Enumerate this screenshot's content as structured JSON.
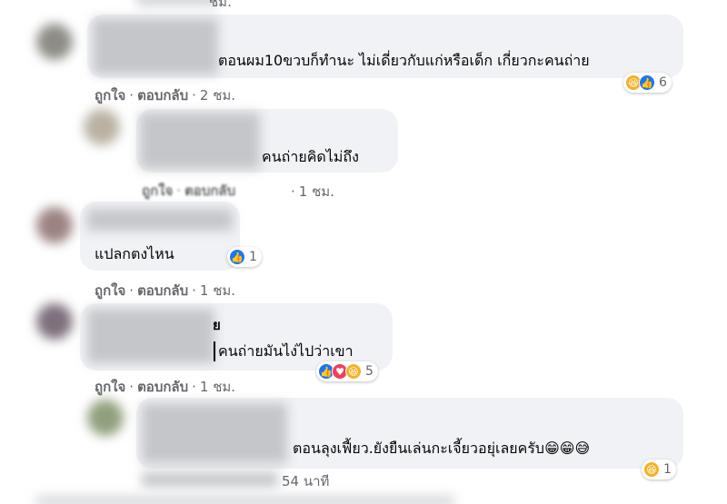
{
  "top_fragment": "ชม.",
  "comments": [
    {
      "text": "ตอนผม10ขวบก็ทำนะ ไม่เดี่ยวกับแก่หรือเด็ก เกี่ยวกะคนถ่าย",
      "like": "ถูกใจ",
      "reply": "ตอบกลับ",
      "time": "2 ชม.",
      "reaction_count": "6"
    },
    {
      "text": "คนถ่ายคิดไม่ถึง",
      "like": "ถูกใจ",
      "reply": "ตอบกลับ",
      "time": "1 ชม."
    },
    {
      "text": "แปลกตงไหน",
      "like": "ถูกใจ",
      "reply": "ตอบกลับ",
      "time": "1 ชม.",
      "reaction_count": "1"
    },
    {
      "name_fragment": "ย",
      "text": "คนถ่ายมันไง่ไปว่าเขา",
      "like": "ถูกใจ",
      "reply": "ตอบกลับ",
      "time": "1 ชม.",
      "reaction_count": "5"
    },
    {
      "text": "ตอนลุงเฟี้ยว.ยังยืนเล่นกะเจี้ยวอยุ่เลยครับ😁😁😅",
      "time": "54 นาที",
      "reaction_count": "1"
    }
  ],
  "colors": {
    "bubble": "#f0f2f5",
    "meta": "#65676b",
    "like": "#1877f2",
    "love": "#f33e58",
    "haha": "#f7b125"
  }
}
